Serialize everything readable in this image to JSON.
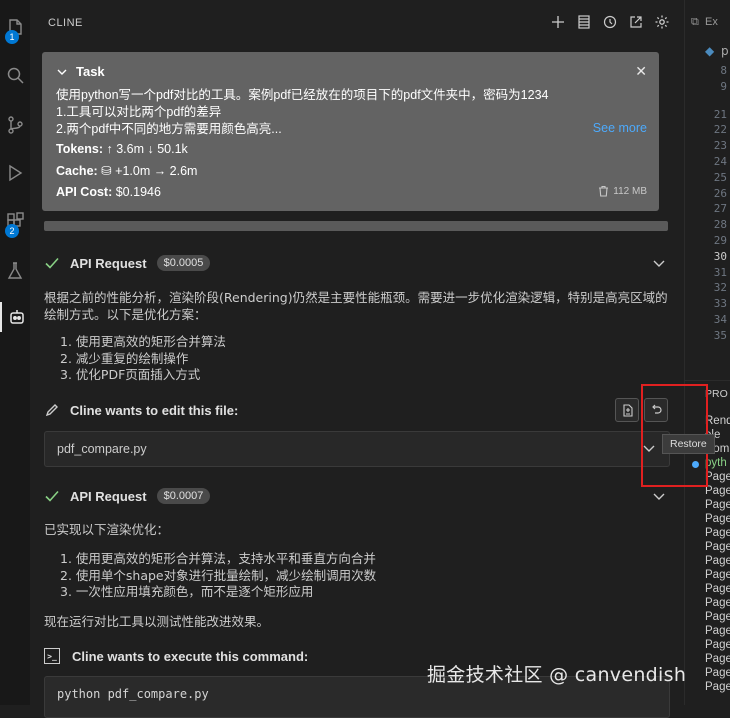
{
  "activity_bar": {
    "explorer_badge": "1",
    "extensions_badge": "2"
  },
  "panel": {
    "title": "CLINE"
  },
  "task": {
    "title": "Task",
    "lines": [
      "使用python写一个pdf对比的工具。案例pdf已经放在的项目下的pdf文件夹中，密码为1234",
      "1.工具可以对比两个pdf的差异",
      "2.两个pdf中不同的地方需要用颜色高亮..."
    ],
    "see_more": "See more",
    "tokens_label": "Tokens:",
    "tokens_value": "↑ 3.6m ↓ 50.1k",
    "cache_label": "Cache:",
    "cache_value": "+1.0m → 2.6m",
    "cost_label": "API Cost:",
    "cost_value": "$0.1946",
    "size": "112 MB"
  },
  "request1": {
    "label": "API Request",
    "cost": "$0.0005",
    "text": "根据之前的性能分析，渲染阶段(Rendering)仍然是主要性能瓶颈。需要进一步优化渲染逻辑，特别是高亮区域的绘制方式。以下是优化方案：",
    "items": [
      "1. 使用更高效的矩形合并算法",
      "2. 减少重复的绘制操作",
      "3. 优化PDF页面插入方式"
    ]
  },
  "edit": {
    "label": "Cline wants to edit this file:",
    "file": "pdf_compare.py",
    "tooltip": "Restore"
  },
  "request2": {
    "label": "API Request",
    "cost": "$0.0007",
    "intro": "已实现以下渲染优化：",
    "items": [
      "1. 使用更高效的矩形合并算法，支持水平和垂直方向合并",
      "2. 使用单个shape对象进行批量绘制，减少绘制调用次数",
      "3. 一次性应用填充颜色，而不是逐个矩形应用"
    ],
    "after": "现在运行对比工具以测试性能改进效果。"
  },
  "execute": {
    "label": "Cline wants to execute this command:",
    "command": "python pdf_compare.py"
  },
  "editor": {
    "tab": "Ex",
    "crumb": "p",
    "line_numbers": [
      "8",
      "9",
      "21",
      "22",
      "23",
      "24",
      "25",
      "26",
      "27",
      "28",
      "29",
      "30",
      "31",
      "32",
      "33",
      "34",
      "35"
    ],
    "current_line": "30",
    "problems_title": "PRO",
    "outline": [
      "Rend",
      "ele",
      "Comp",
      "pyth",
      "Page",
      "Page",
      "Page",
      "Page",
      "Page",
      "Page",
      "Page",
      "Page",
      "Page",
      "Page",
      "Page",
      "Page",
      "Page",
      "Page",
      "Page",
      "Page"
    ]
  },
  "watermark": "掘金技术社区 @ canvendish"
}
